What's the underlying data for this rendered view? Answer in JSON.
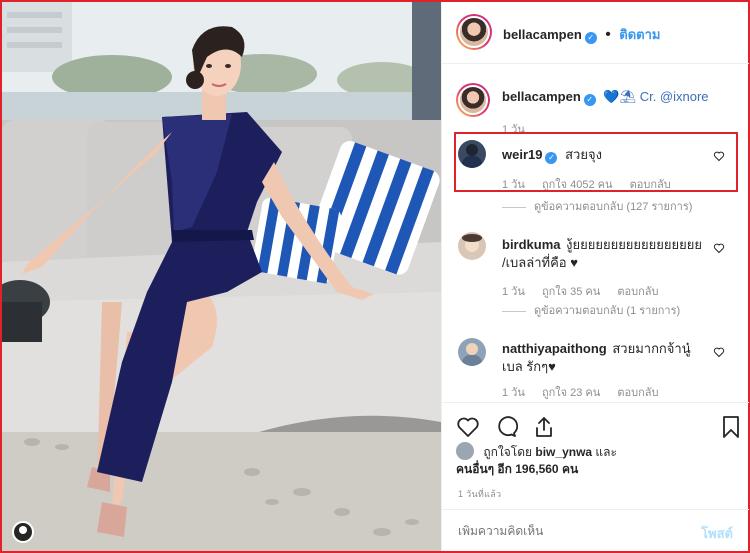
{
  "post_header": {
    "username": "bellacampen",
    "separator": "•",
    "follow_label": "ติดตาม"
  },
  "caption": {
    "username": "bellacampen",
    "text": "💙⛱ Cr. @ixnore",
    "time": "1 วัน"
  },
  "comments": [
    {
      "username": "weir19",
      "verified": true,
      "text": "สวยจุง",
      "time": "1 วัน",
      "likes": "ถูกใจ 4052 คน",
      "reply_label": "ตอบกลับ",
      "view_replies": "ดูข้อความตอบกลับ (127 รายการ)"
    },
    {
      "username": "birdkuma",
      "text_line1": "งู้ยยยยยยยยยยยยยยยยย",
      "text_line2": "/เบลล่าที่คือ ♥",
      "time": "1 วัน",
      "likes": "ถูกใจ 35 คน",
      "reply_label": "ตอบกลับ",
      "view_replies": "ดูข้อความตอบกลับ (1 รายการ)"
    },
    {
      "username": "natthiyapaithong",
      "text_line1": "สวยมากกจ้านู๋",
      "text_line2": "เบล รักๆ♥",
      "time": "1 วัน",
      "likes": "ถูกใจ 23 คน",
      "reply_label": "ตอบกลับ"
    }
  ],
  "liked_by": {
    "prefix": "ถูกใจโดย",
    "user": "biw_ynwa",
    "and": "และ",
    "others_label": "คนอื่นๆ อีก 196,560 คน"
  },
  "time_ago": "1 วันที่แล้ว",
  "comment_box": {
    "placeholder": "เพิ่มความคิดเห็น",
    "post_label": "โพสต์"
  },
  "icons": [
    "heart-icon",
    "comment-icon",
    "share-icon",
    "bookmark-icon",
    "verified-icon"
  ],
  "colors": {
    "highlight_border": "#e0232b",
    "link_blue": "#3897f0",
    "heart_red": "#c8102e"
  }
}
